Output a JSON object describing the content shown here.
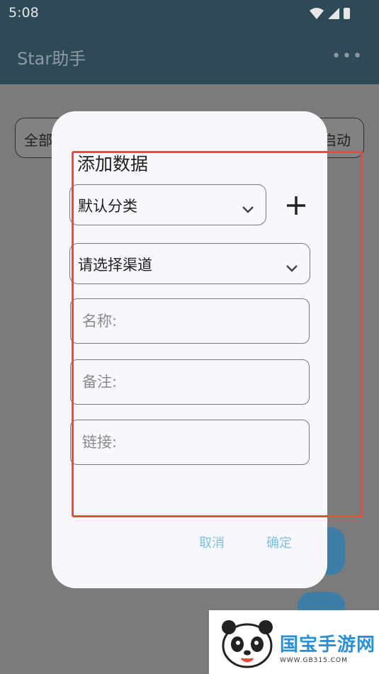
{
  "status_bar": {
    "time": "5:08"
  },
  "app_bar": {
    "title": "Star助手",
    "menu_icon": "more-dots-icon"
  },
  "filters": {
    "left_chip": "全部",
    "right_chip": "启动"
  },
  "dialog": {
    "title": "添加数据",
    "category_select": {
      "value": "默认分类"
    },
    "channel_select": {
      "value": "请选择渠道"
    },
    "fields": {
      "name_placeholder": "名称:",
      "remark_placeholder": "备注:",
      "link_placeholder": "链接:"
    },
    "cancel_label": "取消",
    "confirm_label": "确定"
  },
  "watermark": {
    "name": "国宝手游网",
    "url": "WWW.GB315.COM"
  },
  "colors": {
    "app_bar": "#2f4a57",
    "dialog_bg": "#f8f7fc",
    "action_text": "#7cc0e6",
    "highlight": "#e0503c",
    "fab": "#3e7ea6"
  }
}
